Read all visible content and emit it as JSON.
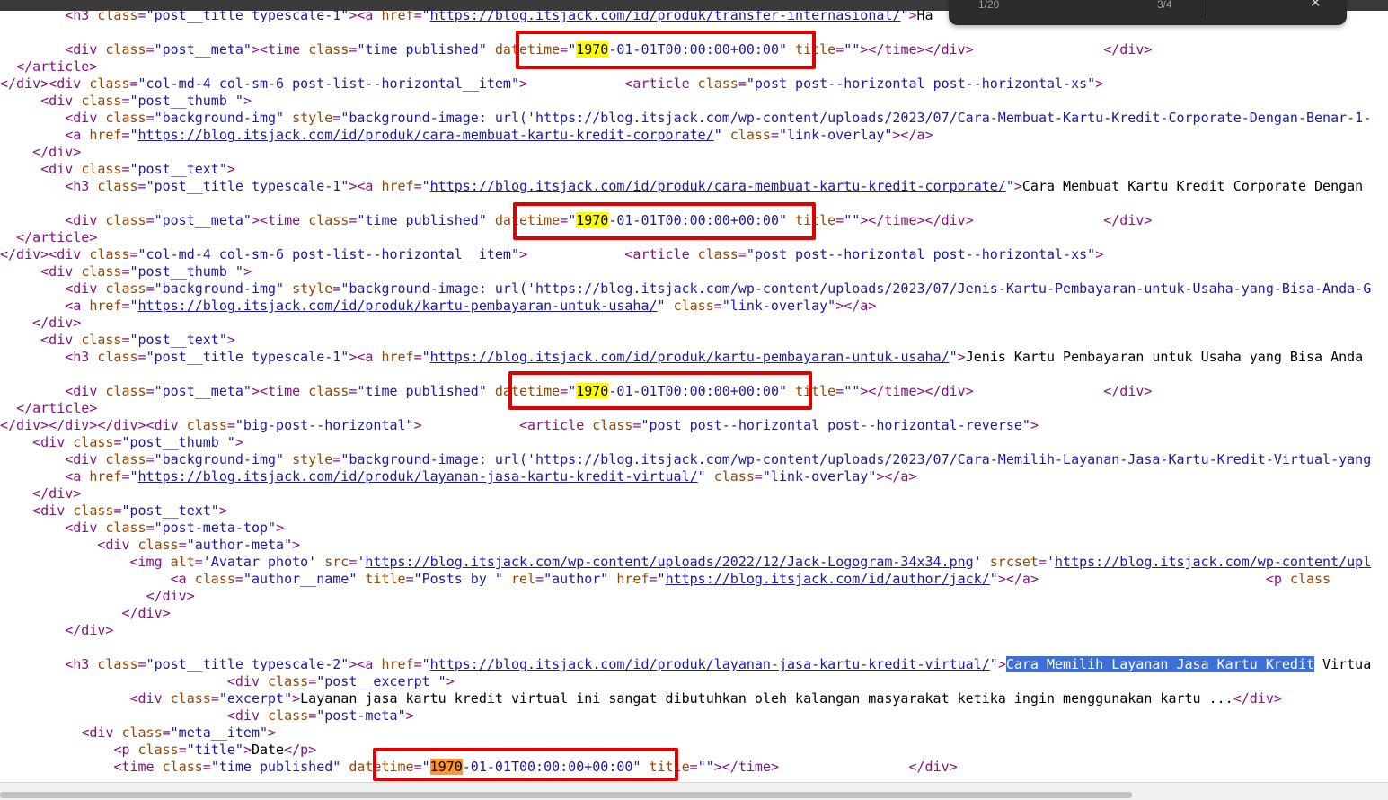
{
  "find_bar": {
    "match_count": "1/20",
    "total": "3/4",
    "close_label": "✕"
  },
  "lines": [
    {
      "indent": "        ",
      "html": "<span class=\"t\">&lt;h3 </span><span class=\"a\">class</span><span class=\"t\">=</span><span class=\"v\">\"post__title typescale-1\"</span><span class=\"t\">&gt;&lt;a </span><span class=\"a\">href</span><span class=\"t\">=</span><span class=\"v\">\"</span><span class=\"u\">https://blog.itsjack.com/id/produk/transfer-internasional/</span><span class=\"v\">\"</span><span class=\"t\">&gt;</span><span class=\"x\">Ha</span>"
    },
    {
      "indent": "",
      "html": ""
    },
    {
      "indent": "        ",
      "html": "<span class=\"t\">&lt;div </span><span class=\"a\">class</span><span class=\"t\">=</span><span class=\"v\">\"post__meta\"</span><span class=\"t\">&gt;&lt;time </span><span class=\"a\">class</span><span class=\"t\">=</span><span class=\"v\">\"time published\"</span> <span class=\"a\">datetime</span><span class=\"t\">=</span><span class=\"v\">\"<span class=\"hl\">1970</span>-01-01T00:00:00+00:00\"</span> <span class=\"a\">title</span><span class=\"t\">=</span><span class=\"v\">\"\"</span><span class=\"t\">&gt;&lt;/time&gt;&lt;/div&gt;</span>                <span class=\"t\">&lt;/div&gt;</span>"
    },
    {
      "indent": "  ",
      "html": "<span class=\"t\">&lt;/article&gt;</span>"
    },
    {
      "indent": "",
      "html": "<span class=\"t\">&lt;/div&gt;&lt;div </span><span class=\"a\">class</span><span class=\"t\">=</span><span class=\"v\">\"col-md-4 col-sm-6 post-list--horizontal__item\"</span><span class=\"t\">&gt;</span>            <span class=\"t\">&lt;article </span><span class=\"a\">class</span><span class=\"t\">=</span><span class=\"v\">\"post post--horizontal post--horizontal-xs\"</span><span class=\"t\">&gt;</span>"
    },
    {
      "indent": "     ",
      "html": "<span class=\"t\">&lt;div </span><span class=\"a\">class</span><span class=\"t\">=</span><span class=\"v\">\"post__thumb \"</span><span class=\"t\">&gt;</span>"
    },
    {
      "indent": "        ",
      "html": "<span class=\"t\">&lt;div </span><span class=\"a\">class</span><span class=\"t\">=</span><span class=\"v\">\"background-img\"</span> <span class=\"a\">style</span><span class=\"t\">=</span><span class=\"v\">\"background-image: url('https://blog.itsjack.com/wp-content/uploads/2023/07/Cara-Membuat-Kartu-Kredit-Corporate-Dengan-Benar-1-</span>"
    },
    {
      "indent": "        ",
      "html": "<span class=\"t\">&lt;a </span><span class=\"a\">href</span><span class=\"t\">=</span><span class=\"v\">\"</span><span class=\"u\">https://blog.itsjack.com/id/produk/cara-membuat-kartu-kredit-corporate/</span><span class=\"v\">\"</span> <span class=\"a\">class</span><span class=\"t\">=</span><span class=\"v\">\"link-overlay\"</span><span class=\"t\">&gt;&lt;/a&gt;</span>"
    },
    {
      "indent": "    ",
      "html": "<span class=\"t\">&lt;/div&gt;</span>"
    },
    {
      "indent": "     ",
      "html": "<span class=\"t\">&lt;div </span><span class=\"a\">class</span><span class=\"t\">=</span><span class=\"v\">\"post__text\"</span><span class=\"t\">&gt;</span>"
    },
    {
      "indent": "        ",
      "html": "<span class=\"t\">&lt;h3 </span><span class=\"a\">class</span><span class=\"t\">=</span><span class=\"v\">\"post__title typescale-1\"</span><span class=\"t\">&gt;&lt;a </span><span class=\"a\">href</span><span class=\"t\">=</span><span class=\"v\">\"</span><span class=\"u\">https://blog.itsjack.com/id/produk/cara-membuat-kartu-kredit-corporate/</span><span class=\"v\">\"</span><span class=\"t\">&gt;</span><span class=\"x\">Cara Membuat Kartu Kredit Corporate Dengan</span>"
    },
    {
      "indent": "",
      "html": ""
    },
    {
      "indent": "        ",
      "html": "<span class=\"t\">&lt;div </span><span class=\"a\">class</span><span class=\"t\">=</span><span class=\"v\">\"post__meta\"</span><span class=\"t\">&gt;&lt;time </span><span class=\"a\">class</span><span class=\"t\">=</span><span class=\"v\">\"time published\"</span> <span class=\"a\">datetime</span><span class=\"t\">=</span><span class=\"v\">\"<span class=\"hl\">1970</span>-01-01T00:00:00+00:00\"</span> <span class=\"a\">title</span><span class=\"t\">=</span><span class=\"v\">\"\"</span><span class=\"t\">&gt;&lt;/time&gt;&lt;/div&gt;</span>                <span class=\"t\">&lt;/div&gt;</span>"
    },
    {
      "indent": "  ",
      "html": "<span class=\"t\">&lt;/article&gt;</span>"
    },
    {
      "indent": "",
      "html": "<span class=\"t\">&lt;/div&gt;&lt;div </span><span class=\"a\">class</span><span class=\"t\">=</span><span class=\"v\">\"col-md-4 col-sm-6 post-list--horizontal__item\"</span><span class=\"t\">&gt;</span>            <span class=\"t\">&lt;article </span><span class=\"a\">class</span><span class=\"t\">=</span><span class=\"v\">\"post post--horizontal post--horizontal-xs\"</span><span class=\"t\">&gt;</span>"
    },
    {
      "indent": "     ",
      "html": "<span class=\"t\">&lt;div </span><span class=\"a\">class</span><span class=\"t\">=</span><span class=\"v\">\"post__thumb \"</span><span class=\"t\">&gt;</span>"
    },
    {
      "indent": "        ",
      "html": "<span class=\"t\">&lt;div </span><span class=\"a\">class</span><span class=\"t\">=</span><span class=\"v\">\"background-img\"</span> <span class=\"a\">style</span><span class=\"t\">=</span><span class=\"v\">\"background-image: url('https://blog.itsjack.com/wp-content/uploads/2023/07/Jenis-Kartu-Pembayaran-untuk-Usaha-yang-Bisa-Anda-G</span>"
    },
    {
      "indent": "        ",
      "html": "<span class=\"t\">&lt;a </span><span class=\"a\">href</span><span class=\"t\">=</span><span class=\"v\">\"</span><span class=\"u\">https://blog.itsjack.com/id/produk/kartu-pembayaran-untuk-usaha/</span><span class=\"v\">\"</span> <span class=\"a\">class</span><span class=\"t\">=</span><span class=\"v\">\"link-overlay\"</span><span class=\"t\">&gt;&lt;/a&gt;</span>"
    },
    {
      "indent": "    ",
      "html": "<span class=\"t\">&lt;/div&gt;</span>"
    },
    {
      "indent": "     ",
      "html": "<span class=\"t\">&lt;div </span><span class=\"a\">class</span><span class=\"t\">=</span><span class=\"v\">\"post__text\"</span><span class=\"t\">&gt;</span>"
    },
    {
      "indent": "        ",
      "html": "<span class=\"t\">&lt;h3 </span><span class=\"a\">class</span><span class=\"t\">=</span><span class=\"v\">\"post__title typescale-1\"</span><span class=\"t\">&gt;&lt;a </span><span class=\"a\">href</span><span class=\"t\">=</span><span class=\"v\">\"</span><span class=\"u\">https://blog.itsjack.com/id/produk/kartu-pembayaran-untuk-usaha/</span><span class=\"v\">\"</span><span class=\"t\">&gt;</span><span class=\"x\">Jenis Kartu Pembayaran untuk Usaha yang Bisa Anda</span>"
    },
    {
      "indent": "",
      "html": ""
    },
    {
      "indent": "        ",
      "html": "<span class=\"t\">&lt;div </span><span class=\"a\">class</span><span class=\"t\">=</span><span class=\"v\">\"post__meta\"</span><span class=\"t\">&gt;&lt;time </span><span class=\"a\">class</span><span class=\"t\">=</span><span class=\"v\">\"time published\"</span> <span class=\"a\">datetime</span><span class=\"t\">=</span><span class=\"v\">\"<span class=\"hl\">1970</span>-01-01T00:00:00+00:00\"</span> <span class=\"a\">title</span><span class=\"t\">=</span><span class=\"v\">\"\"</span><span class=\"t\">&gt;&lt;/time&gt;&lt;/div&gt;</span>                <span class=\"t\">&lt;/div&gt;</span>"
    },
    {
      "indent": "  ",
      "html": "<span class=\"t\">&lt;/article&gt;</span>"
    },
    {
      "indent": "",
      "html": "<span class=\"t\">&lt;/div&gt;&lt;/div&gt;&lt;/div&gt;&lt;div </span><span class=\"a\">class</span><span class=\"t\">=</span><span class=\"v\">\"big-post--horizontal\"</span><span class=\"t\">&gt;</span>            <span class=\"t\">&lt;article </span><span class=\"a\">class</span><span class=\"t\">=</span><span class=\"v\">\"post post--horizontal post--horizontal-reverse\"</span><span class=\"t\">&gt;</span>"
    },
    {
      "indent": "    ",
      "html": "<span class=\"t\">&lt;div </span><span class=\"a\">class</span><span class=\"t\">=</span><span class=\"v\">\"post__thumb \"</span><span class=\"t\">&gt;</span>"
    },
    {
      "indent": "        ",
      "html": "<span class=\"t\">&lt;div </span><span class=\"a\">class</span><span class=\"t\">=</span><span class=\"v\">\"background-img\"</span> <span class=\"a\">style</span><span class=\"t\">=</span><span class=\"v\">\"background-image: url('https://blog.itsjack.com/wp-content/uploads/2023/07/Cara-Memilih-Layanan-Jasa-Kartu-Kredit-Virtual-yang</span>"
    },
    {
      "indent": "        ",
      "html": "<span class=\"t\">&lt;a </span><span class=\"a\">href</span><span class=\"t\">=</span><span class=\"v\">\"</span><span class=\"u\">https://blog.itsjack.com/id/produk/layanan-jasa-kartu-kredit-virtual/</span><span class=\"v\">\"</span> <span class=\"a\">class</span><span class=\"t\">=</span><span class=\"v\">\"link-overlay\"</span><span class=\"t\">&gt;&lt;/a&gt;</span>"
    },
    {
      "indent": "    ",
      "html": "<span class=\"t\">&lt;/div&gt;</span>"
    },
    {
      "indent": "    ",
      "html": "<span class=\"t\">&lt;div </span><span class=\"a\">class</span><span class=\"t\">=</span><span class=\"v\">\"post__text\"</span><span class=\"t\">&gt;</span>"
    },
    {
      "indent": "        ",
      "html": "<span class=\"t\">&lt;div </span><span class=\"a\">class</span><span class=\"t\">=</span><span class=\"v\">\"post-meta-top\"</span><span class=\"t\">&gt;</span>"
    },
    {
      "indent": "            ",
      "html": "<span class=\"t\">&lt;div </span><span class=\"a\">class</span><span class=\"t\">=</span><span class=\"v\">\"author-meta\"</span><span class=\"t\">&gt;</span>"
    },
    {
      "indent": "                ",
      "html": "<span class=\"t\">&lt;img </span><span class=\"a\">alt</span><span class=\"t\">=</span><span class=\"v\">'Avatar photo'</span> <span class=\"a\">src</span><span class=\"t\">=</span><span class=\"v\">'</span><span class=\"u\">https://blog.itsjack.com/wp-content/uploads/2022/12/Jack-Logogram-34x34.png</span><span class=\"v\">'</span> <span class=\"a\">srcset</span><span class=\"t\">=</span><span class=\"v\">'</span><span class=\"u\">https://blog.itsjack.com/wp-content/upl</span>"
    },
    {
      "indent": "                     ",
      "html": "<span class=\"t\">&lt;a </span><span class=\"a\">class</span><span class=\"t\">=</span><span class=\"v\">\"author__name\"</span> <span class=\"a\">title</span><span class=\"t\">=</span><span class=\"v\">\"Posts by \"</span> <span class=\"a\">rel</span><span class=\"t\">=</span><span class=\"v\">\"author\"</span> <span class=\"a\">href</span><span class=\"t\">=</span><span class=\"v\">\"</span><span class=\"u\">https://blog.itsjack.com/id/author/jack/</span><span class=\"v\">\"</span><span class=\"t\">&gt;&lt;/a&gt;</span>                            <span class=\"t\">&lt;p </span><span class=\"a\">class</span>"
    },
    {
      "indent": "                  ",
      "html": "<span class=\"t\">&lt;/div&gt;</span>"
    },
    {
      "indent": "               ",
      "html": "<span class=\"t\">&lt;/div&gt;</span>"
    },
    {
      "indent": "        ",
      "html": "<span class=\"t\">&lt;/div&gt;</span>"
    },
    {
      "indent": "",
      "html": ""
    },
    {
      "indent": "        ",
      "html": "<span class=\"t\">&lt;h3 </span><span class=\"a\">class</span><span class=\"t\">=</span><span class=\"v\">\"post__title typescale-2\"</span><span class=\"t\">&gt;&lt;a </span><span class=\"a\">href</span><span class=\"t\">=</span><span class=\"v\">\"</span><span class=\"u\">https://blog.itsjack.com/id/produk/layanan-jasa-kartu-kredit-virtual/</span><span class=\"v\">\"</span><span class=\"t\">&gt;</span><span class=\"sel\">Cara Memilih Layanan Jasa Kartu Kredit</span><span class=\"x\"> Virtua</span>"
    },
    {
      "indent": "                            ",
      "html": "<span class=\"t\">&lt;div </span><span class=\"a\">class</span><span class=\"t\">=</span><span class=\"v\">\"post__excerpt \"</span><span class=\"t\">&gt;</span>"
    },
    {
      "indent": "                ",
      "html": "<span class=\"t\">&lt;div </span><span class=\"a\">class</span><span class=\"t\">=</span><span class=\"v\">\"excerpt\"</span><span class=\"t\">&gt;</span><span class=\"x\">Layanan jasa kartu kredit virtual ini sangat dibutuhkan oleh kalangan masyarakat ketika ingin menggunakan kartu ...</span><span class=\"t\">&lt;/div&gt;</span>"
    },
    {
      "indent": "                            ",
      "html": "<span class=\"t\">&lt;div </span><span class=\"a\">class</span><span class=\"t\">=</span><span class=\"v\">\"post-meta\"</span><span class=\"t\">&gt;</span>"
    },
    {
      "indent": "          ",
      "html": "<span class=\"t\">&lt;div </span><span class=\"a\">class</span><span class=\"t\">=</span><span class=\"v\">\"meta__item\"</span><span class=\"t\">&gt;</span>"
    },
    {
      "indent": "              ",
      "html": "<span class=\"t\">&lt;p </span><span class=\"a\">class</span><span class=\"t\">=</span><span class=\"v\">\"title\"</span><span class=\"t\">&gt;</span><span class=\"x\">Date</span><span class=\"t\">&lt;/p&gt;</span>"
    },
    {
      "indent": "              ",
      "html": "<span class=\"t\">&lt;time </span><span class=\"a\">class</span><span class=\"t\">=</span><span class=\"v\">\"time published\"</span> <span class=\"a\">datetime</span><span class=\"t\">=</span><span class=\"v\">\"<span class=\"hl-cur\">1970</span>-01-01T00:00:00+00:00\"</span> <span class=\"a\">title</span><span class=\"t\">=</span><span class=\"v\">\"\"</span><span class=\"t\">&gt;&lt;/time&gt;</span>                <span class=\"t\">&lt;/div&gt;</span>"
    }
  ]
}
